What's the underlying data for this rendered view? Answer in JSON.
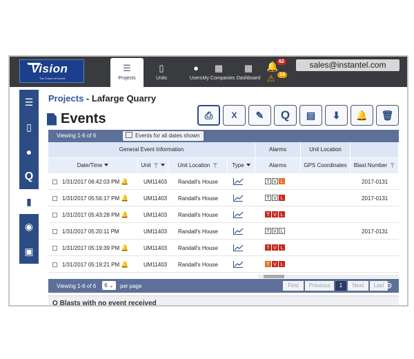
{
  "logo": {
    "brand": "Vision",
    "tagline": "The Future of Events"
  },
  "nav": [
    {
      "label": "Projects",
      "icon": "projects-icon"
    },
    {
      "label": "Units",
      "icon": "units-icon"
    },
    {
      "label": "Users",
      "icon": "users-icon"
    },
    {
      "label": "My Companies",
      "icon": "companies-icon"
    },
    {
      "label": "Dashboard",
      "icon": "dashboard-icon"
    }
  ],
  "alerts": {
    "bell_count": "62",
    "warning_count": "14"
  },
  "user": {
    "email": "sales@instantel.com"
  },
  "breadcrumb": {
    "link": "Projects",
    "separator": " - ",
    "current": "Lafarge Quarry"
  },
  "page": {
    "title": "Events"
  },
  "toolbar": {
    "print": "print-icon",
    "excel": "excel-icon",
    "edit": "edit-icon",
    "query": "Q",
    "pdf": "pdf-icon",
    "download": "download-icon",
    "alarm": "bell-icon",
    "delete": "trash-icon"
  },
  "viewing": {
    "text": "Viewing 1-6 of 6",
    "dates_button": "Events for all dates shown"
  },
  "table": {
    "group_headers": {
      "general": "General Event Information",
      "alarms": "Alarms",
      "location": "Unit Location"
    },
    "columns": {
      "datetime": "Date/Time",
      "unit": "Unit",
      "unit_location": "Unit Location",
      "type": "Type",
      "alarms": "Alarms",
      "gps": "GPS Coordinates",
      "blast": "Blast Number"
    },
    "rows": [
      {
        "datetime": "1/31/2017 06:42:03 PM",
        "bell": true,
        "unit": "UM11403",
        "location": "Randall's House",
        "alarms": [
          "T",
          "V",
          "L"
        ],
        "alarm_state": [
          "off",
          "off",
          "warn"
        ],
        "blast": "2017-0131"
      },
      {
        "datetime": "1/31/2017 05:56:17 PM",
        "bell": true,
        "unit": "UM11403",
        "location": "Randall's House",
        "alarms": [
          "T",
          "V",
          "L"
        ],
        "alarm_state": [
          "off",
          "off",
          "on"
        ],
        "blast": "2017-0131"
      },
      {
        "datetime": "1/31/2017 05:43:28 PM",
        "bell": true,
        "unit": "UM11403",
        "location": "Randall's House",
        "alarms": [
          "T",
          "V",
          "L"
        ],
        "alarm_state": [
          "on",
          "on",
          "on"
        ],
        "blast": ""
      },
      {
        "datetime": "1/31/2017 05:20:11 PM",
        "bell": false,
        "unit": "UM11403",
        "location": "Randall's House",
        "alarms": [
          "T",
          "V",
          "L"
        ],
        "alarm_state": [
          "off",
          "off",
          "off"
        ],
        "blast": "2017-0131"
      },
      {
        "datetime": "1/31/2017 05:19:39 PM",
        "bell": true,
        "unit": "UM11403",
        "location": "Randall's House",
        "alarms": [
          "T",
          "V",
          "L"
        ],
        "alarm_state": [
          "on",
          "on",
          "on"
        ],
        "blast": ""
      },
      {
        "datetime": "1/31/2017 05:19:21 PM",
        "bell": true,
        "unit": "UM11403",
        "location": "Randall's House",
        "alarms": [
          "T",
          "V",
          "L"
        ],
        "alarm_state": [
          "warn",
          "on",
          "on"
        ],
        "blast": ""
      }
    ]
  },
  "pager": {
    "viewing": "Viewing 1-6 of 6",
    "per_page_value": "6",
    "per_page_label": "per page",
    "first": "First",
    "previous": "Previous",
    "current": "1",
    "next": "Next",
    "last": "Last"
  },
  "blasts_section": {
    "title": "Blasts with no event received"
  },
  "colors": {
    "nav_bg": "#3a3b3e",
    "brand_blue": "#2c4c86",
    "alarm_red": "#c8281e",
    "bell_red": "#d62020"
  }
}
